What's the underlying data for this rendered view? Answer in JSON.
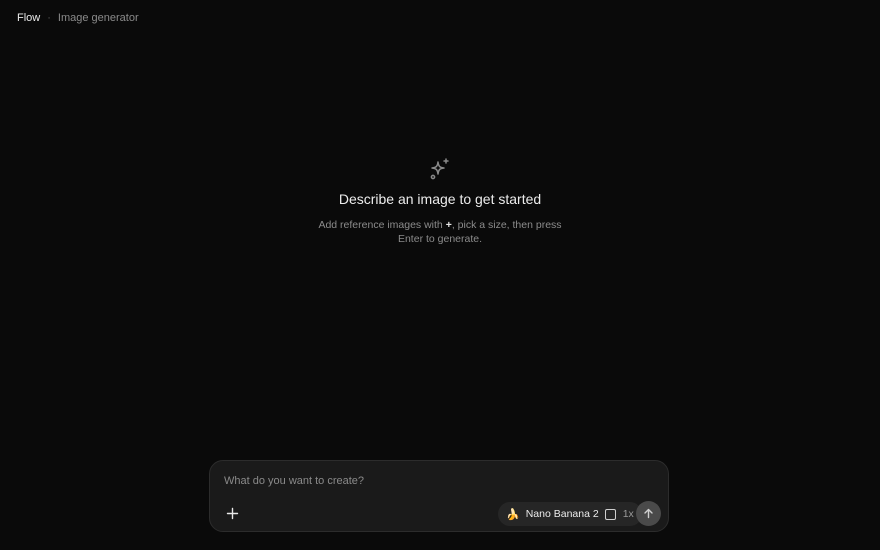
{
  "header": {
    "brand": "Flow",
    "separator": "·",
    "subtitle": "Image generator"
  },
  "empty_state": {
    "icon": "sparkles-icon",
    "title": "Describe an image to get started",
    "hint_before": "Add reference images with ",
    "hint_plus": "+",
    "hint_after": ", pick a size, then press Enter to generate."
  },
  "composer": {
    "placeholder": "What do you want to create?",
    "value": "",
    "add_icon": "plus-icon",
    "model": {
      "emoji": "🍌",
      "name": "Nano Banana 2",
      "ratio_icon": "square-ratio-icon",
      "count": "1x"
    },
    "send_icon": "arrow-up-icon"
  },
  "colors": {
    "background": "#0a0a0a",
    "composer_bg": "#1a1a1a",
    "pill_bg": "#262626",
    "send_bg": "#4a4a4a"
  }
}
